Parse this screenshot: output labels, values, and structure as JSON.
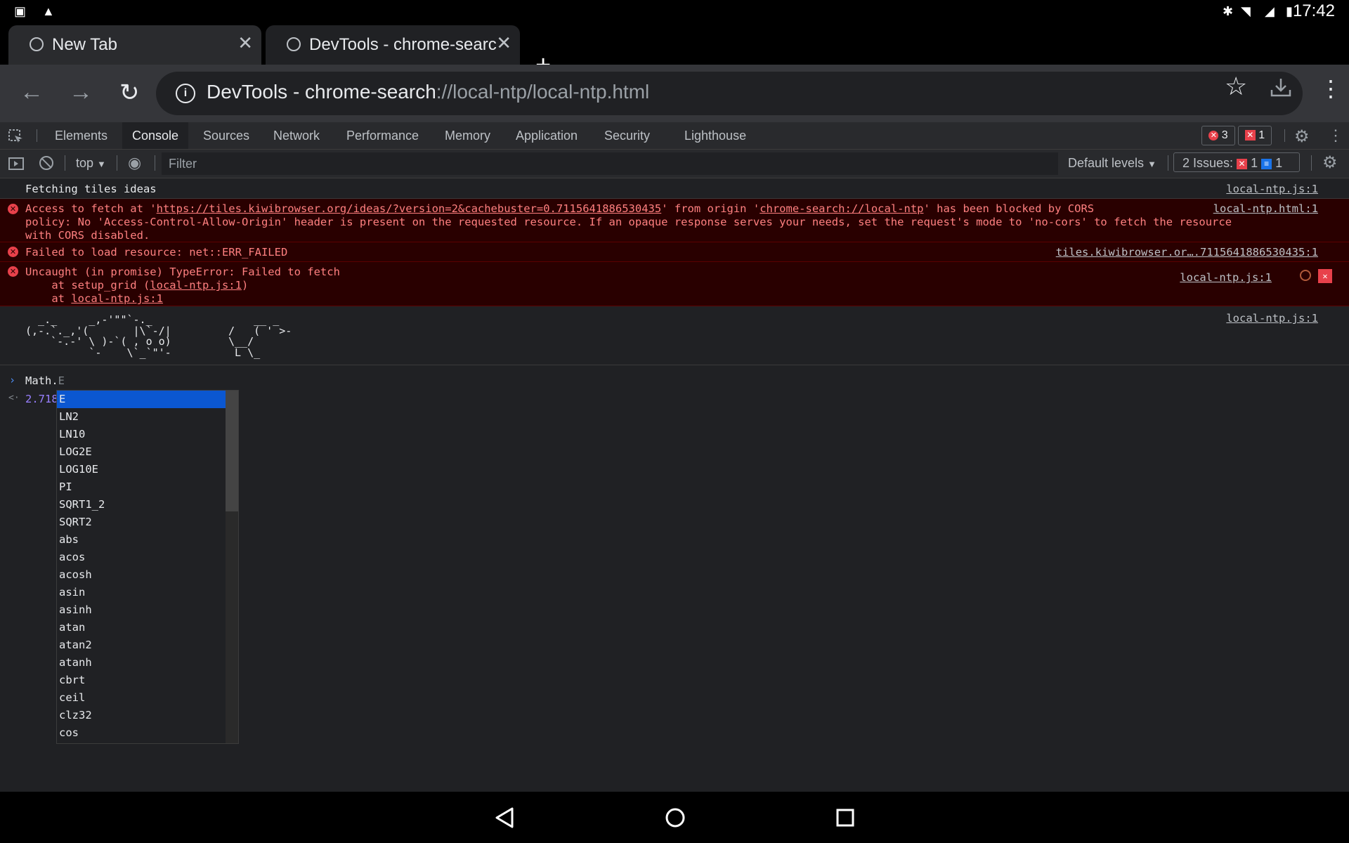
{
  "status_bar": {
    "time": "17:42"
  },
  "tabs": [
    {
      "title": "New Tab",
      "active": false
    },
    {
      "title": "DevTools - chrome-searc",
      "active": true
    }
  ],
  "toolbar": {
    "url_host": "DevTools - chrome-search",
    "url_path": "://local-ntp/local-ntp.html"
  },
  "devtools": {
    "tabs": [
      "Elements",
      "Console",
      "Sources",
      "Network",
      "Performance",
      "Memory",
      "Application",
      "Security",
      "Lighthouse"
    ],
    "active_tab": "Console",
    "error_count": "3",
    "warning_count": "1"
  },
  "console_toolbar": {
    "context": "top",
    "filter_placeholder": "Filter",
    "levels": "Default levels",
    "issues_label": "2 Issues:",
    "issues_errors": "1",
    "issues_info": "1"
  },
  "messages": {
    "m1": {
      "text": "Fetching tiles ideas",
      "source": "local-ntp.js:1"
    },
    "m2": {
      "pre": "Access to fetch at '",
      "link": "https://tiles.kiwibrowser.org/ideas/?version=2&cachebuster=0.7115641886530435",
      "mid": "' from origin '",
      "origin": "chrome-search://local-ntp",
      "post": "' has been blocked by CORS",
      "line2": "policy: No 'Access-Control-Allow-Origin' header is present on the requested resource. If an opaque response serves your needs, set the request's mode to 'no-cors' to fetch the resource",
      "line3": "with CORS disabled.",
      "source": "local-ntp.html:1"
    },
    "m3": {
      "text": "Failed to load resource: net::ERR_FAILED",
      "source": "tiles.kiwibrowser.or….7115641886530435:1"
    },
    "m4": {
      "line1": "Uncaught (in promise) TypeError: Failed to fetch",
      "line2_pre": "    at setup_grid (",
      "line2_link": "local-ntp.js:1",
      "line2_post": ")",
      "line3_pre": "    at ",
      "line3_link": "local-ntp.js:1",
      "source": "local-ntp.js:1"
    },
    "m5": {
      "ascii": "  _._     _,-'\"\"`-._                __ _\n(,-.`._,'(       |\\`-/|         /   ( ' >-\n    `-.-' \\ )-`( , o o)         \\__/\n          `-    \\`_`\"'-          L \\_",
      "source": "local-ntp.js:1"
    }
  },
  "prompt": {
    "typed": "Math.",
    "ghost": "E",
    "result": "2.718"
  },
  "autocomplete": [
    "E",
    "LN2",
    "LN10",
    "LOG2E",
    "LOG10E",
    "PI",
    "SQRT1_2",
    "SQRT2",
    "abs",
    "acos",
    "acosh",
    "asin",
    "asinh",
    "atan",
    "atan2",
    "atanh",
    "cbrt",
    "ceil",
    "clz32",
    "cos"
  ],
  "autocomplete_selected": "E"
}
